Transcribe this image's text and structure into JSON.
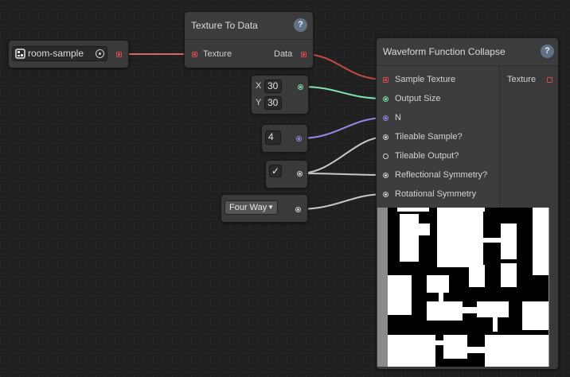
{
  "colors": {
    "texture_wire": "#d84a4a",
    "output_size_wire": "#7fe3b0",
    "n_wire": "#9b86e8",
    "plain_wire": "#c8c8c8"
  },
  "asset_node": {
    "object_name": "room-sample",
    "object_icon": "texture-asset-icon",
    "picker_icon": "object-picker-icon"
  },
  "texture_to_data": {
    "title": "Texture To Data",
    "help": "?",
    "input_label": "Texture",
    "output_label": "Data"
  },
  "output_size_node": {
    "x_label": "X",
    "x_value": "30",
    "y_label": "Y",
    "y_value": "30"
  },
  "n_node": {
    "value": "4"
  },
  "bool_node": {
    "checked": "✓"
  },
  "symmetry_node": {
    "selected": "Four Way",
    "caret": "▼"
  },
  "wfc": {
    "title": "Waveform Function Collapse",
    "help": "?",
    "output_label": "Texture",
    "inputs": [
      {
        "label": "Sample Texture"
      },
      {
        "label": "Output Size"
      },
      {
        "label": "N"
      },
      {
        "label": "Tileable Sample?"
      },
      {
        "label": "Tileable Output?"
      },
      {
        "label": "Reflectional Symmetry?"
      },
      {
        "label": "Rotational Symmetry"
      }
    ]
  }
}
